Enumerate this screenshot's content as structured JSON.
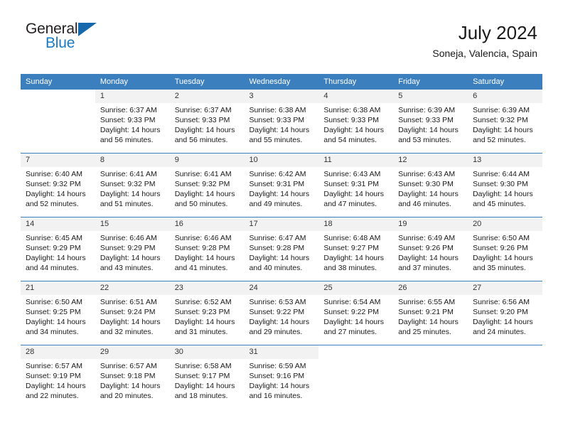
{
  "brand": {
    "name_part1": "General",
    "name_part2": "Blue",
    "accent_color": "#1a7bc4",
    "triangle_color": "#1668ad"
  },
  "header": {
    "title": "July 2024",
    "subtitle": "Soneja, Valencia, Spain"
  },
  "theme": {
    "header_row_bg": "#3c7fbf",
    "daynum_bg": "#f2f2f2",
    "separator_color": "#3c7fbf",
    "text_color": "#1a1a1a"
  },
  "calendar": {
    "weekday_headers": [
      "Sunday",
      "Monday",
      "Tuesday",
      "Wednesday",
      "Thursday",
      "Friday",
      "Saturday"
    ],
    "weeks": [
      [
        {
          "day": "",
          "blank": true,
          "sunrise": "",
          "sunset": "",
          "daylight_line1": "",
          "daylight_line2": ""
        },
        {
          "day": "1",
          "sunrise": "Sunrise: 6:37 AM",
          "sunset": "Sunset: 9:33 PM",
          "daylight_line1": "Daylight: 14 hours",
          "daylight_line2": "and 56 minutes."
        },
        {
          "day": "2",
          "sunrise": "Sunrise: 6:37 AM",
          "sunset": "Sunset: 9:33 PM",
          "daylight_line1": "Daylight: 14 hours",
          "daylight_line2": "and 56 minutes."
        },
        {
          "day": "3",
          "sunrise": "Sunrise: 6:38 AM",
          "sunset": "Sunset: 9:33 PM",
          "daylight_line1": "Daylight: 14 hours",
          "daylight_line2": "and 55 minutes."
        },
        {
          "day": "4",
          "sunrise": "Sunrise: 6:38 AM",
          "sunset": "Sunset: 9:33 PM",
          "daylight_line1": "Daylight: 14 hours",
          "daylight_line2": "and 54 minutes."
        },
        {
          "day": "5",
          "sunrise": "Sunrise: 6:39 AM",
          "sunset": "Sunset: 9:33 PM",
          "daylight_line1": "Daylight: 14 hours",
          "daylight_line2": "and 53 minutes."
        },
        {
          "day": "6",
          "sunrise": "Sunrise: 6:39 AM",
          "sunset": "Sunset: 9:32 PM",
          "daylight_line1": "Daylight: 14 hours",
          "daylight_line2": "and 52 minutes."
        }
      ],
      [
        {
          "day": "7",
          "sunrise": "Sunrise: 6:40 AM",
          "sunset": "Sunset: 9:32 PM",
          "daylight_line1": "Daylight: 14 hours",
          "daylight_line2": "and 52 minutes."
        },
        {
          "day": "8",
          "sunrise": "Sunrise: 6:41 AM",
          "sunset": "Sunset: 9:32 PM",
          "daylight_line1": "Daylight: 14 hours",
          "daylight_line2": "and 51 minutes."
        },
        {
          "day": "9",
          "sunrise": "Sunrise: 6:41 AM",
          "sunset": "Sunset: 9:32 PM",
          "daylight_line1": "Daylight: 14 hours",
          "daylight_line2": "and 50 minutes."
        },
        {
          "day": "10",
          "sunrise": "Sunrise: 6:42 AM",
          "sunset": "Sunset: 9:31 PM",
          "daylight_line1": "Daylight: 14 hours",
          "daylight_line2": "and 49 minutes."
        },
        {
          "day": "11",
          "sunrise": "Sunrise: 6:43 AM",
          "sunset": "Sunset: 9:31 PM",
          "daylight_line1": "Daylight: 14 hours",
          "daylight_line2": "and 47 minutes."
        },
        {
          "day": "12",
          "sunrise": "Sunrise: 6:43 AM",
          "sunset": "Sunset: 9:30 PM",
          "daylight_line1": "Daylight: 14 hours",
          "daylight_line2": "and 46 minutes."
        },
        {
          "day": "13",
          "sunrise": "Sunrise: 6:44 AM",
          "sunset": "Sunset: 9:30 PM",
          "daylight_line1": "Daylight: 14 hours",
          "daylight_line2": "and 45 minutes."
        }
      ],
      [
        {
          "day": "14",
          "sunrise": "Sunrise: 6:45 AM",
          "sunset": "Sunset: 9:29 PM",
          "daylight_line1": "Daylight: 14 hours",
          "daylight_line2": "and 44 minutes."
        },
        {
          "day": "15",
          "sunrise": "Sunrise: 6:46 AM",
          "sunset": "Sunset: 9:29 PM",
          "daylight_line1": "Daylight: 14 hours",
          "daylight_line2": "and 43 minutes."
        },
        {
          "day": "16",
          "sunrise": "Sunrise: 6:46 AM",
          "sunset": "Sunset: 9:28 PM",
          "daylight_line1": "Daylight: 14 hours",
          "daylight_line2": "and 41 minutes."
        },
        {
          "day": "17",
          "sunrise": "Sunrise: 6:47 AM",
          "sunset": "Sunset: 9:28 PM",
          "daylight_line1": "Daylight: 14 hours",
          "daylight_line2": "and 40 minutes."
        },
        {
          "day": "18",
          "sunrise": "Sunrise: 6:48 AM",
          "sunset": "Sunset: 9:27 PM",
          "daylight_line1": "Daylight: 14 hours",
          "daylight_line2": "and 38 minutes."
        },
        {
          "day": "19",
          "sunrise": "Sunrise: 6:49 AM",
          "sunset": "Sunset: 9:26 PM",
          "daylight_line1": "Daylight: 14 hours",
          "daylight_line2": "and 37 minutes."
        },
        {
          "day": "20",
          "sunrise": "Sunrise: 6:50 AM",
          "sunset": "Sunset: 9:26 PM",
          "daylight_line1": "Daylight: 14 hours",
          "daylight_line2": "and 35 minutes."
        }
      ],
      [
        {
          "day": "21",
          "sunrise": "Sunrise: 6:50 AM",
          "sunset": "Sunset: 9:25 PM",
          "daylight_line1": "Daylight: 14 hours",
          "daylight_line2": "and 34 minutes."
        },
        {
          "day": "22",
          "sunrise": "Sunrise: 6:51 AM",
          "sunset": "Sunset: 9:24 PM",
          "daylight_line1": "Daylight: 14 hours",
          "daylight_line2": "and 32 minutes."
        },
        {
          "day": "23",
          "sunrise": "Sunrise: 6:52 AM",
          "sunset": "Sunset: 9:23 PM",
          "daylight_line1": "Daylight: 14 hours",
          "daylight_line2": "and 31 minutes."
        },
        {
          "day": "24",
          "sunrise": "Sunrise: 6:53 AM",
          "sunset": "Sunset: 9:22 PM",
          "daylight_line1": "Daylight: 14 hours",
          "daylight_line2": "and 29 minutes."
        },
        {
          "day": "25",
          "sunrise": "Sunrise: 6:54 AM",
          "sunset": "Sunset: 9:22 PM",
          "daylight_line1": "Daylight: 14 hours",
          "daylight_line2": "and 27 minutes."
        },
        {
          "day": "26",
          "sunrise": "Sunrise: 6:55 AM",
          "sunset": "Sunset: 9:21 PM",
          "daylight_line1": "Daylight: 14 hours",
          "daylight_line2": "and 25 minutes."
        },
        {
          "day": "27",
          "sunrise": "Sunrise: 6:56 AM",
          "sunset": "Sunset: 9:20 PM",
          "daylight_line1": "Daylight: 14 hours",
          "daylight_line2": "and 24 minutes."
        }
      ],
      [
        {
          "day": "28",
          "sunrise": "Sunrise: 6:57 AM",
          "sunset": "Sunset: 9:19 PM",
          "daylight_line1": "Daylight: 14 hours",
          "daylight_line2": "and 22 minutes."
        },
        {
          "day": "29",
          "sunrise": "Sunrise: 6:57 AM",
          "sunset": "Sunset: 9:18 PM",
          "daylight_line1": "Daylight: 14 hours",
          "daylight_line2": "and 20 minutes."
        },
        {
          "day": "30",
          "sunrise": "Sunrise: 6:58 AM",
          "sunset": "Sunset: 9:17 PM",
          "daylight_line1": "Daylight: 14 hours",
          "daylight_line2": "and 18 minutes."
        },
        {
          "day": "31",
          "sunrise": "Sunrise: 6:59 AM",
          "sunset": "Sunset: 9:16 PM",
          "daylight_line1": "Daylight: 14 hours",
          "daylight_line2": "and 16 minutes."
        },
        {
          "day": "",
          "blank": true,
          "sunrise": "",
          "sunset": "",
          "daylight_line1": "",
          "daylight_line2": ""
        },
        {
          "day": "",
          "blank": true,
          "sunrise": "",
          "sunset": "",
          "daylight_line1": "",
          "daylight_line2": ""
        },
        {
          "day": "",
          "blank": true,
          "sunrise": "",
          "sunset": "",
          "daylight_line1": "",
          "daylight_line2": ""
        }
      ]
    ]
  }
}
